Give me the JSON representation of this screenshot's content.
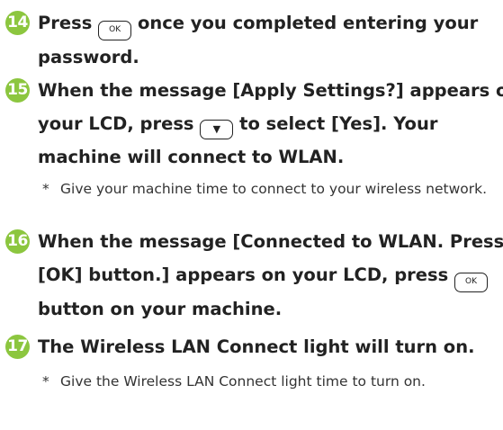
{
  "accent_color": "#8cc63f",
  "steps": [
    {
      "number": "14",
      "line1_before": "Press",
      "line1_key": "OK",
      "line1_after": "once you completed entering your",
      "line2": "password."
    },
    {
      "number": "15",
      "line1": "When the message [Apply Settings?] appears on",
      "line2_before": "your LCD, press",
      "line2_key": "▼",
      "line2_after": "to select [Yes]. Your",
      "line3": "machine will connect to WLAN.",
      "note_marker": "*",
      "note": "Give your machine time to connect to your wireless network."
    },
    {
      "number": "16",
      "line1": "When the message [Connected to WLAN. Press",
      "line2_before": "[OK] button.] appears on your LCD, press",
      "line2_key": "OK",
      "line3": "button on your machine."
    },
    {
      "number": "17",
      "line1": "The Wireless LAN Connect light will turn on.",
      "note_marker": "*",
      "note": "Give the Wireless LAN Connect light time to turn on."
    }
  ]
}
